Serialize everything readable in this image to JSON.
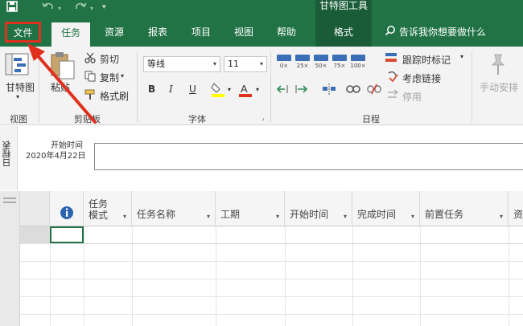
{
  "title_bar": {
    "quick_access": {
      "save_icon": "save-icon",
      "undo_icon": "undo-icon",
      "redo_icon": "redo-icon",
      "more_icon": "chevron-down-icon"
    },
    "contextual_group": "甘特图工具"
  },
  "tabs": {
    "file": "文件",
    "task": "任务",
    "resource": "资源",
    "report": "报表",
    "project": "项目",
    "view": "视图",
    "help": "帮助",
    "format": "格式",
    "tell_me": "告诉我你想要做什么"
  },
  "ribbon": {
    "view_group": {
      "gantt_label": "甘特图",
      "group_label": "视图"
    },
    "clipboard_group": {
      "paste": "粘贴",
      "cut": "剪切",
      "copy": "复制",
      "format_painter": "格式刷",
      "group_label": "剪贴板"
    },
    "font_group": {
      "font_name": "等线",
      "font_size": "11",
      "bold": "B",
      "italic": "I",
      "underline": "U",
      "group_label": "字体"
    },
    "schedule_group": {
      "percents": [
        "0×",
        "25×",
        "50×",
        "75×",
        "100×"
      ],
      "mark_on_track": "跟踪时标记",
      "respect_links": "考虑链接",
      "inactivate": "停用",
      "manual_schedule": "手动安排",
      "group_label": "日程"
    },
    "colors": {
      "accent": "#217346",
      "highlight": "#e0301e"
    }
  },
  "timeline": {
    "vertical_label": "日程表",
    "start_label": "开始时间",
    "start_date": "2020年4月22日"
  },
  "grid": {
    "headers": [
      "任务模式",
      "任务名称",
      "工期",
      "开始时间",
      "完成时间",
      "前置任务",
      "资"
    ],
    "info_icon": "info-icon"
  }
}
